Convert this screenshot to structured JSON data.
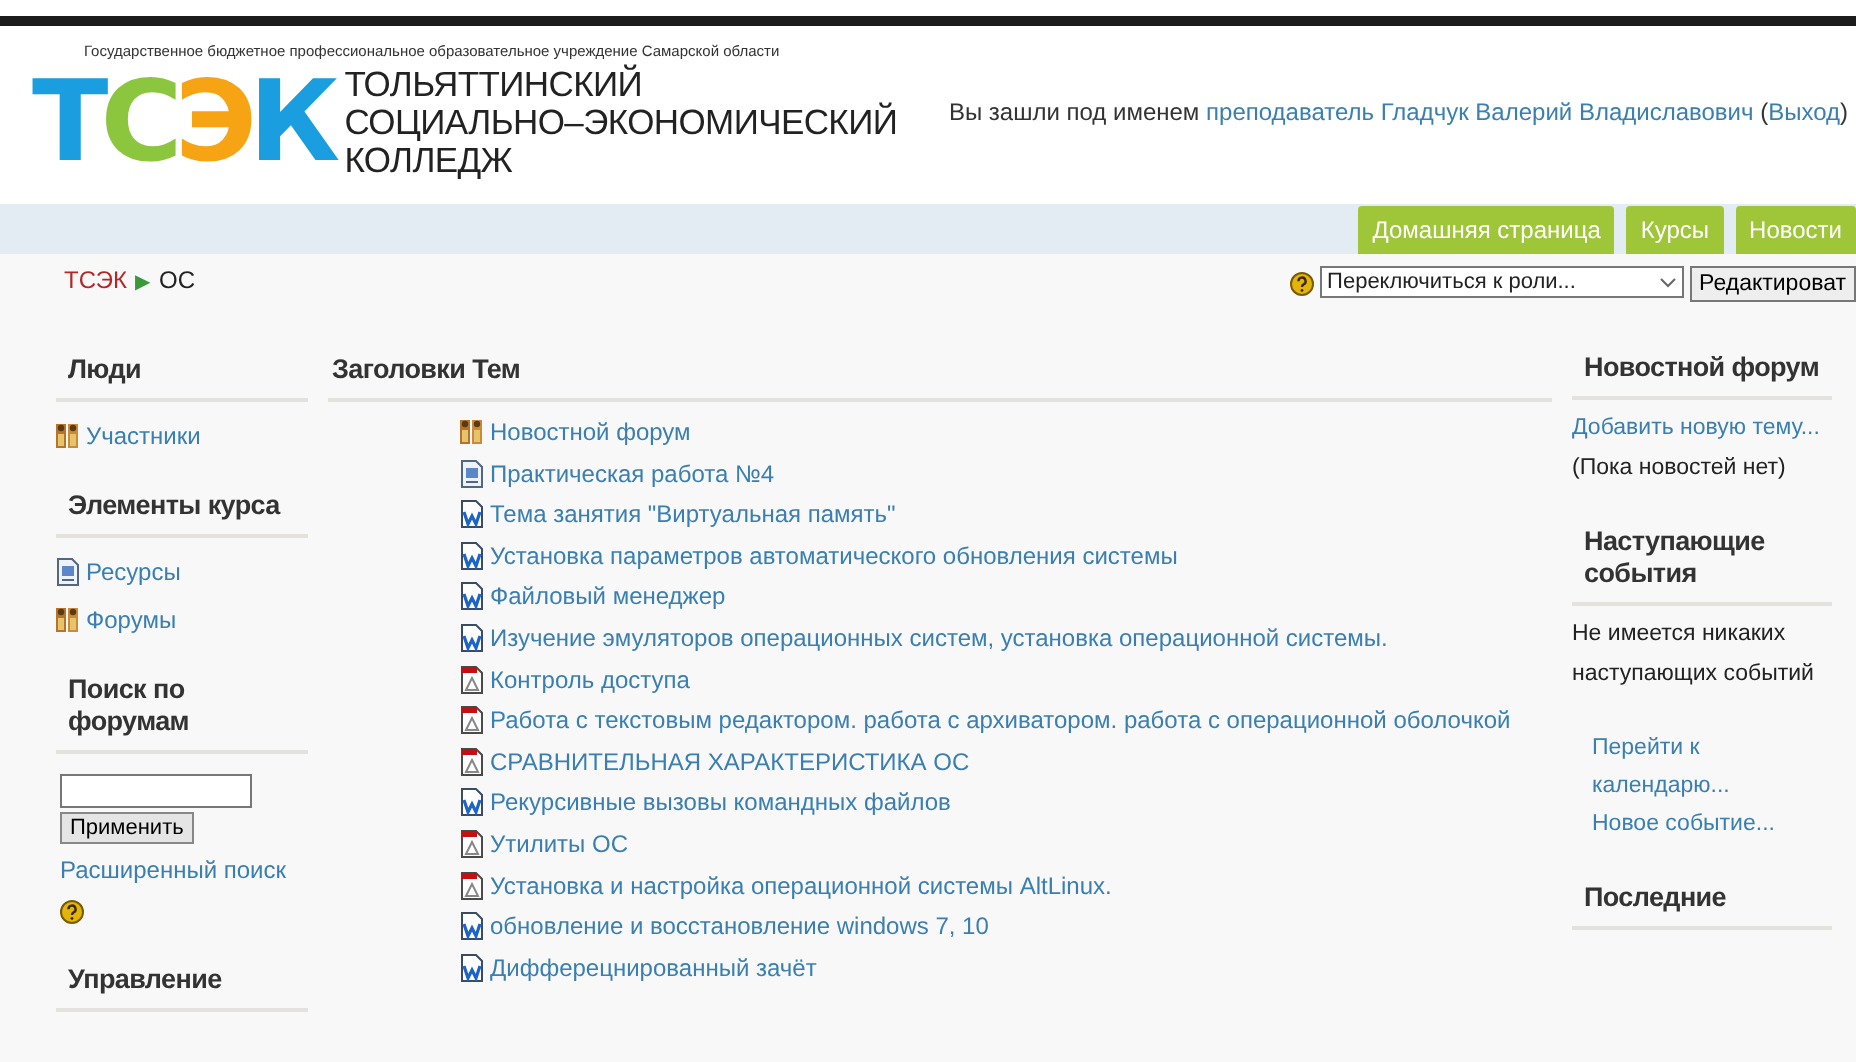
{
  "header": {
    "org_line": "Государственное бюджетное профессиональное образовательное учреждение Самарской области",
    "logo_mark": "ТСЭК",
    "logo_lines": [
      "ТОЛЬЯТТИНСКИЙ",
      "СОЦИАЛЬНО–ЭКОНОМИЧЕСКИЙ",
      "КОЛЛЕДЖ"
    ],
    "login_prefix": "Вы зашли под именем",
    "user_name": "преподаватель Гладчук Валерий Владиславович",
    "logout_open": "(",
    "logout": "Выход",
    "logout_close": ")"
  },
  "nav_tabs": [
    {
      "label": "Домашняя страница"
    },
    {
      "label": "Курсы"
    },
    {
      "label": "Новости"
    }
  ],
  "breadcrumb": {
    "root": "ТСЭК",
    "separator": "▶",
    "current": "ОС"
  },
  "toolbar": {
    "role_select": "Переключиться к роли...",
    "edit_button": "Редактироват"
  },
  "left_blocks": [
    {
      "kind": "links",
      "title": "Люди",
      "items": [
        {
          "kind": "people",
          "label": "Участники"
        }
      ]
    },
    {
      "kind": "links",
      "title": "Элементы курса",
      "items": [
        {
          "kind": "page",
          "label": "Ресурсы"
        },
        {
          "kind": "forum",
          "label": "Форумы"
        }
      ]
    },
    {
      "kind": "search",
      "title": "Поиск по форумам",
      "button": "Применить",
      "link": "Расширенный поиск"
    },
    {
      "kind": "links",
      "title": "Управление"
    }
  ],
  "main": {
    "title": "Заголовки Тем",
    "items": [
      {
        "kind": "forum",
        "label": "Новостной форум"
      },
      {
        "kind": "page",
        "label": "Практическая работа №4"
      },
      {
        "kind": "doc",
        "label": "Тема занятия \"Виртуальная память\""
      },
      {
        "kind": "doc",
        "label": "Установка параметров автоматического обновления системы"
      },
      {
        "kind": "doc",
        "label": "Файловый менеджер"
      },
      {
        "kind": "doc",
        "label": "Изучение эмуляторов операционных систем, установка операционной системы."
      },
      {
        "kind": "pdf",
        "label": "Контроль доступа"
      },
      {
        "kind": "pdf",
        "label": "Работа с текстовым редактором. работа с архиватором. работа с операционной оболочкой"
      },
      {
        "kind": "pdf",
        "label": "СРАВНИТЕЛЬНАЯ ХАРАКТЕРИСТИКА ОС"
      },
      {
        "kind": "doc",
        "label": "Рекурсивные вызовы командных файлов"
      },
      {
        "kind": "pdf",
        "label": "Утилиты ОС"
      },
      {
        "kind": "pdf",
        "label": "Установка и настройка операционной системы AltLinux."
      },
      {
        "kind": "doc",
        "label": "обновление и восстановление windows 7, 10"
      },
      {
        "kind": "doc",
        "label": "Дифферецнированный зачёт"
      }
    ]
  },
  "right_blocks": [
    {
      "title": "Новостной форум",
      "lines": [
        {
          "kind": "link",
          "text": "Добавить новую тему..."
        },
        {
          "kind": "text",
          "text": "(Пока новостей нет)"
        }
      ]
    },
    {
      "title": "Наступающие события",
      "lines": [
        {
          "kind": "text",
          "text": "Не имеется никаких наступающих событий"
        },
        {
          "kind": "spacer"
        },
        {
          "kind": "sublink",
          "text": "Перейти к календарю..."
        },
        {
          "kind": "sublink",
          "text": "Новое событие..."
        }
      ]
    },
    {
      "title": "Последние"
    }
  ]
}
